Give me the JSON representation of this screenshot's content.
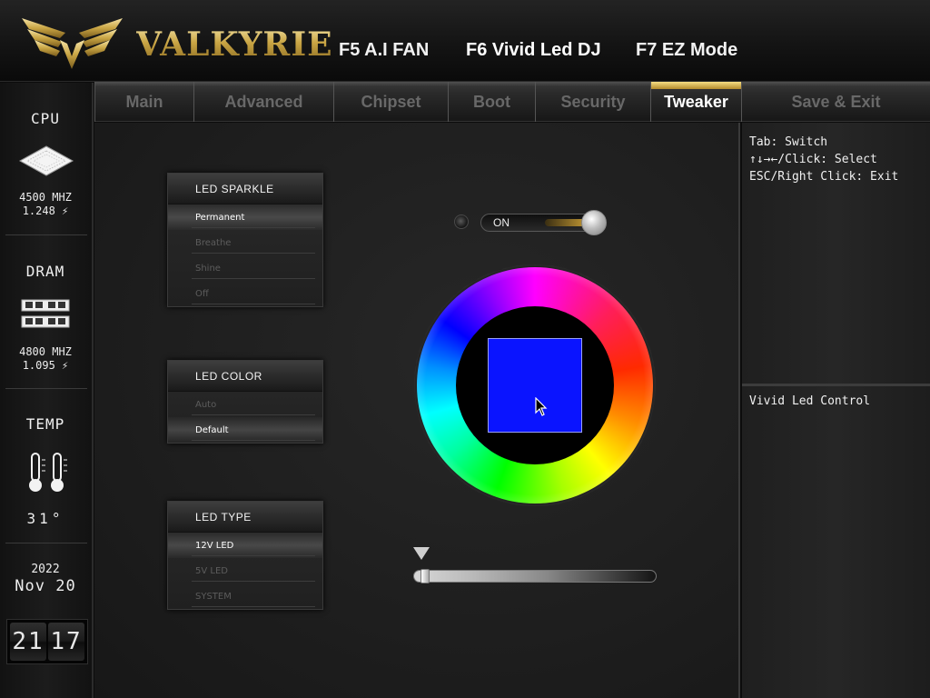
{
  "brand": "VALKYRIE",
  "hotkeys": [
    {
      "label": "F5 A.I FAN"
    },
    {
      "label": "F6 Vivid Led DJ"
    },
    {
      "label": "F7 EZ Mode"
    }
  ],
  "sidebar": {
    "cpu": {
      "title": "CPU",
      "freq": "4500 MHZ",
      "volt": "1.248 ⚡"
    },
    "dram": {
      "title": "DRAM",
      "freq": "4800 MHZ",
      "volt": "1.095 ⚡"
    },
    "temp": {
      "title": "TEMP",
      "value": "31°"
    },
    "date": {
      "year": "2022",
      "month_day": "Nov 20"
    },
    "clock": {
      "hours": "21",
      "minutes": "17"
    }
  },
  "tabs": [
    {
      "label": "Main"
    },
    {
      "label": "Advanced"
    },
    {
      "label": "Chipset"
    },
    {
      "label": "Boot"
    },
    {
      "label": "Security"
    },
    {
      "label": "Tweaker"
    },
    {
      "label": "Save & Exit"
    }
  ],
  "active_tab": "Tweaker",
  "menus": {
    "sparkle": {
      "title": "LED SPARKLE",
      "items": [
        "Permanent",
        "Breathe",
        "Shine",
        "Off"
      ],
      "selected": "Permanent"
    },
    "color": {
      "title": "LED COLOR",
      "items": [
        "Auto",
        "Default"
      ],
      "selected": "Default"
    },
    "type": {
      "title": "LED TYPE",
      "items": [
        "12V LED",
        "5V LED",
        "SYSTEM"
      ],
      "selected": "12V LED"
    }
  },
  "led_toggle": {
    "label": "ON",
    "state": "on"
  },
  "color_picker": {
    "selected_color": "#0a14ff"
  },
  "brightness_slider": {
    "value": 0.02
  },
  "help": {
    "lines": [
      "Tab: Switch",
      "↑↓→←/Click: Select",
      "ESC/Right Click: Exit"
    ],
    "description": "Vivid Led Control"
  },
  "colors": {
    "accent_gold": "#c9a544",
    "background": "#1c1c1c"
  }
}
